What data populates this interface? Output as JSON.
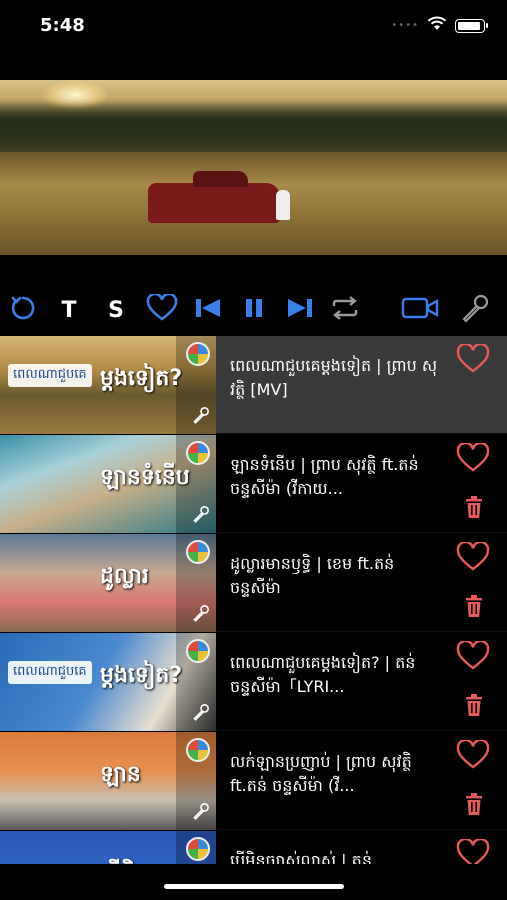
{
  "status": {
    "time": "5:48",
    "dots": "••••",
    "battery_level": 0.9
  },
  "video": {
    "scene": "red-pickup-in-field-sunset"
  },
  "controls": {
    "text_label": "T",
    "s_label": "S",
    "accent_color": "#3a7fe8",
    "icons": [
      "refresh-icon",
      "text-button",
      "s-button",
      "heart-icon",
      "skip-previous-icon",
      "pause-icon",
      "skip-next-icon",
      "repeat-icon",
      "video-camera-icon",
      "microphone-icon"
    ]
  },
  "playlist": [
    {
      "title": "ពេលណាជួបគេម្តងទៀត | ព្រាប សុវត្ថិ [MV]",
      "thumb_caption": "ពេលណាជួបគេ",
      "thumb_caption2": "ម្តងទៀត?",
      "active": true,
      "has_delete": false
    },
    {
      "title": "ឡានទំនើប | ព្រាប សុវត្ថិ ft.តន់ ចន្ទសីម៉ា (វីកាយ...",
      "thumb_caption": "",
      "thumb_caption2": "ឡានទំនើប",
      "active": false,
      "has_delete": true
    },
    {
      "title": "ដូល្លារមានឫទ្ធិ | ខេម ft.តន់ ចន្ទសីម៉ា",
      "thumb_caption": "",
      "thumb_caption2": "ដូល្លារ",
      "active": false,
      "has_delete": true
    },
    {
      "title": "ពេលណាជួបគេម្តងទៀត? | តន់ ចន្ទសីម៉ា「LYRI...",
      "thumb_caption": "ពេលណាជួបគេ",
      "thumb_caption2": "ម្តងទៀត?",
      "active": false,
      "has_delete": true
    },
    {
      "title": "លក់ឡានប្រញាប់ | ព្រាប សុវត្ថិ ft.តន់ ចន្ទសីម៉ា (វី...",
      "thumb_caption": "",
      "thumb_caption2": "ឡាន",
      "active": false,
      "has_delete": true
    },
    {
      "title": "បើមិនច្បាស់លាស់ | តន់",
      "thumb_caption": "",
      "thumb_caption2": "បើមិន",
      "active": false,
      "has_delete": false
    }
  ],
  "colors": {
    "heart": "#e85a5a",
    "trash": "#e85a5a",
    "accent": "#3a7fe8",
    "active_row": "#3a3a3a"
  }
}
